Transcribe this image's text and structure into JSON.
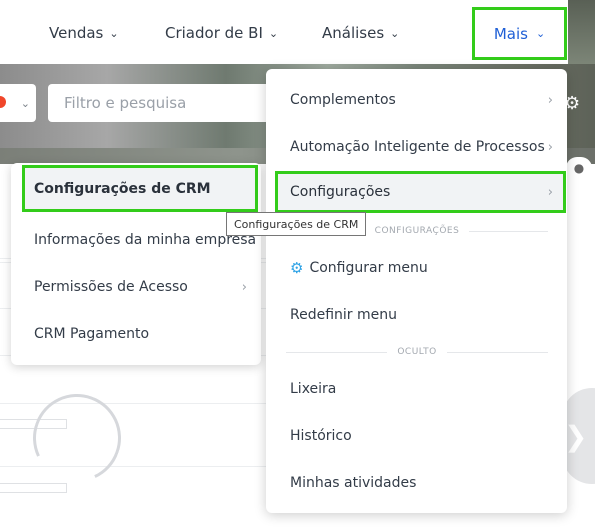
{
  "nav": {
    "items": [
      {
        "label": "Vendas"
      },
      {
        "label": "Criador de BI"
      },
      {
        "label": "Análises"
      }
    ],
    "more_label": "Mais"
  },
  "filter": {
    "placeholder": "Filtro e pesquisa"
  },
  "submenu": {
    "items": [
      {
        "label": "Configurações de CRM"
      },
      {
        "label": "Informações da minha empresa"
      },
      {
        "label": "Permissões de Acesso"
      },
      {
        "label": "CRM Pagamento"
      }
    ]
  },
  "tooltip": {
    "text": "Configurações de CRM"
  },
  "dropdown": {
    "items": [
      {
        "label": "Complementos"
      },
      {
        "label": "Automação Inteligente de Processos"
      },
      {
        "label": "Configurações"
      }
    ],
    "section_config": "CONFIGURAÇÕES",
    "config_items": [
      {
        "label": "Configurar menu",
        "icon": "gear-icon"
      },
      {
        "label": "Redefinir menu"
      }
    ],
    "section_hidden": "OCULTO",
    "hidden_items": [
      {
        "label": "Lixeira"
      },
      {
        "label": "Histórico"
      },
      {
        "label": "Minhas atividades"
      }
    ]
  },
  "colors": {
    "highlight": "#33cc1a",
    "active_nav": "#1f5fd6",
    "status_dot": "#f0462a"
  }
}
